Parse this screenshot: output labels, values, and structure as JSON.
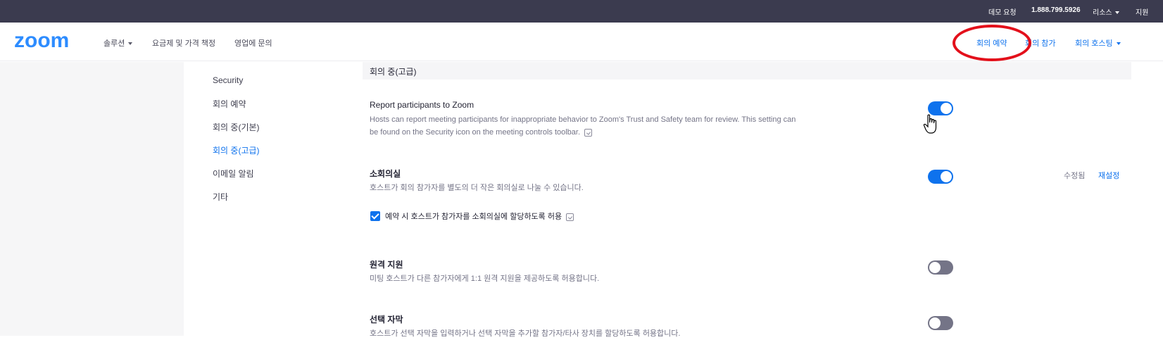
{
  "topbar": {
    "demo": "데모 요청",
    "phone": "1.888.799.5926",
    "resources": "리소스",
    "support": "지원"
  },
  "nav": {
    "logo_text": "zoom",
    "solutions": "솔루션",
    "plans": "요금제 및 가격 책정",
    "contact_sales": "영업에 문의",
    "schedule": "회의 예약",
    "join": "회의 참가",
    "host": "회의 호스팅"
  },
  "sidebar": {
    "items": [
      {
        "label": "Security"
      },
      {
        "label": "회의 예약"
      },
      {
        "label": "회의 중(기본)"
      },
      {
        "label": "회의 중(고급)"
      },
      {
        "label": "이메일 알림"
      },
      {
        "label": "기타"
      }
    ],
    "active_index": 3
  },
  "section": {
    "header": "회의 중(고급)"
  },
  "settings": [
    {
      "title": "Report participants to Zoom",
      "desc": "Hosts can report meeting participants for inappropriate behavior to Zoom's Trust and Safety team for review. This setting can be found on the Security icon on the meeting controls toolbar.",
      "enabled": true
    },
    {
      "title": "소회의실",
      "desc": "호스트가 회의 참가자를 별도의 더 작은 회의실로 나눌 수 있습니다.",
      "enabled": true,
      "modified": "수정됨",
      "reset": "재설정",
      "checkbox_label": "예약 시 호스트가 참가자를 소회의실에 할당하도록 허용",
      "checkbox_checked": true
    },
    {
      "title": "원격 지원",
      "desc": "미팅 호스트가 다른 참가자에게 1:1 원격 지원을 제공하도록 허용합니다.",
      "enabled": false
    },
    {
      "title": "선택 자막",
      "desc": "호스트가 선택 자막을 입력하거나 선택 자막을 추가할 참가자/타사 장치를 할당하도록 허용합니다.",
      "enabled": false
    }
  ],
  "colors": {
    "topbar_bg": "#3b3b4f",
    "accent": "#0e72ed",
    "highlight": "#e3101b",
    "toggle_off": "#747487"
  }
}
